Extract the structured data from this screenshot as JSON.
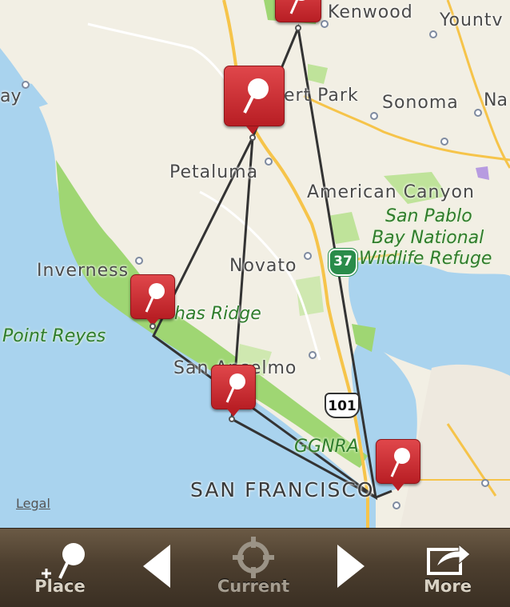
{
  "map": {
    "legal": "Legal",
    "places": [
      {
        "name": "Kenwood"
      },
      {
        "name": "Yountv"
      },
      {
        "name": "ay"
      },
      {
        "name": "hert Park"
      },
      {
        "name": "Sonoma"
      },
      {
        "name": "Na"
      },
      {
        "name": "Petaluma"
      },
      {
        "name": "American Canyon"
      },
      {
        "name": "Inverness"
      },
      {
        "name": "Novato"
      },
      {
        "name": "has Ridge"
      },
      {
        "name": "San Anselmo"
      },
      {
        "name": "SAN FRANCISCO"
      }
    ],
    "parks": [
      {
        "name": "San Pablo"
      },
      {
        "name": "Bay National"
      },
      {
        "name": "Wildlife Refuge"
      },
      {
        "name": "Point Reyes"
      },
      {
        "name": "GGNRA"
      }
    ],
    "highways": [
      "37",
      "101"
    ]
  },
  "toolbar": {
    "place": "Place",
    "prev": "",
    "current": "Current",
    "next": "",
    "more": "More"
  },
  "colors": {
    "water": "#a9d3ee",
    "land": "#f2efe4",
    "park": "#9fd673",
    "pin": "#c8262c",
    "route": "#333333",
    "road": "#f6c44a"
  },
  "icons": [
    "place-pin-icon",
    "previous-arrow-icon",
    "current-location-icon",
    "next-arrow-icon",
    "share-icon"
  ]
}
